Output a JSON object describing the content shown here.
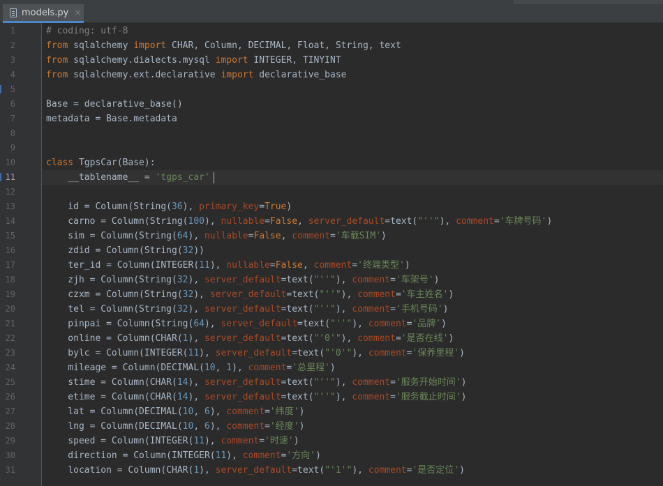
{
  "tab": {
    "label": "models.py",
    "close": "×"
  },
  "lines": [
    {
      "num": "1",
      "text": "# coding: utf-8"
    },
    {
      "num": "2",
      "text": "from sqlalchemy import CHAR, Column, DECIMAL, Float, String, text"
    },
    {
      "num": "3",
      "text": "from sqlalchemy.dialects.mysql import INTEGER, TINYINT"
    },
    {
      "num": "4",
      "text": "from sqlalchemy.ext.declarative import declarative_base"
    },
    {
      "num": "5",
      "text": ""
    },
    {
      "num": "6",
      "text": "Base = declarative_base()"
    },
    {
      "num": "7",
      "text": "metadata = Base.metadata"
    },
    {
      "num": "8",
      "text": ""
    },
    {
      "num": "9",
      "text": ""
    },
    {
      "num": "10",
      "text": "class TgpsCar(Base):"
    },
    {
      "num": "11",
      "text": "    __tablename__ = 'tgps_car'"
    },
    {
      "num": "12",
      "text": ""
    },
    {
      "num": "13",
      "text": "    id = Column(String(36), primary_key=True)"
    },
    {
      "num": "14",
      "text": "    carno = Column(String(100), nullable=False, server_default=text(\"''\"), comment='车牌号码')"
    },
    {
      "num": "15",
      "text": "    sim = Column(String(64), nullable=False, comment='车载SIM')"
    },
    {
      "num": "16",
      "text": "    zdid = Column(String(32))"
    },
    {
      "num": "17",
      "text": "    ter_id = Column(INTEGER(11), nullable=False, comment='终端类型')"
    },
    {
      "num": "18",
      "text": "    zjh = Column(String(32), server_default=text(\"''\"), comment='车架号')"
    },
    {
      "num": "19",
      "text": "    czxm = Column(String(32), server_default=text(\"''\"), comment='车主姓名')"
    },
    {
      "num": "20",
      "text": "    tel = Column(String(32), server_default=text(\"''\"), comment='手机号码')"
    },
    {
      "num": "21",
      "text": "    pinpai = Column(String(64), server_default=text(\"''\"), comment='品牌')"
    },
    {
      "num": "22",
      "text": "    online = Column(CHAR(1), server_default=text(\"'0'\"), comment='是否在线')"
    },
    {
      "num": "23",
      "text": "    bylc = Column(INTEGER(11), server_default=text(\"'0'\"), comment='保养里程')"
    },
    {
      "num": "24",
      "text": "    mileage = Column(DECIMAL(10, 1), comment='总里程')"
    },
    {
      "num": "25",
      "text": "    stime = Column(CHAR(14), server_default=text(\"''\"), comment='服务开始时间')"
    },
    {
      "num": "26",
      "text": "    etime = Column(CHAR(14), server_default=text(\"''\"), comment='服务截止时间')"
    },
    {
      "num": "27",
      "text": "    lat = Column(DECIMAL(10, 6), comment='纬度')"
    },
    {
      "num": "28",
      "text": "    lng = Column(DECIMAL(10, 6), comment='经度')"
    },
    {
      "num": "29",
      "text": "    speed = Column(INTEGER(11), comment='时速')"
    },
    {
      "num": "30",
      "text": "    direction = Column(INTEGER(11), comment='方向')"
    },
    {
      "num": "31",
      "text": "    location = Column(CHAR(1), server_default=text(\"'1'\"), comment='是否定位')"
    }
  ],
  "active_line": "11",
  "colors": {
    "keyword": "#cc7832",
    "string": "#6a8759",
    "comment": "#808080",
    "number": "#6897bb",
    "kwarg": "#aa4926",
    "default": "#a9b7c6"
  }
}
